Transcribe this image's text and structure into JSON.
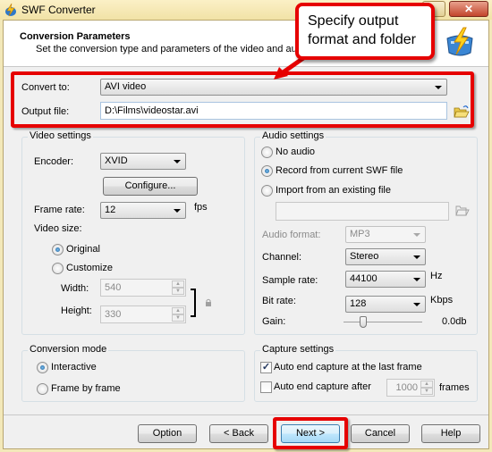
{
  "window": {
    "title": "SWF Converter",
    "close_glyph": "✕"
  },
  "header": {
    "title": "Conversion Parameters",
    "subtitle": "Set the conversion type and parameters of the video and audio",
    "logo_icon": "lightning-film-icon"
  },
  "annotation": {
    "callout_line1": "Specify output",
    "callout_line2": "format and folder",
    "color": "#e60000"
  },
  "output": {
    "convert_to_label": "Convert to:",
    "convert_to_value": "AVI video",
    "output_file_label": "Output file:",
    "output_file_value": "D:\\Films\\videostar.avi"
  },
  "video": {
    "group_title": "Video settings",
    "encoder_label": "Encoder:",
    "encoder_value": "XVID",
    "configure_label": "Configure...",
    "frame_rate_label": "Frame rate:",
    "frame_rate_value": "12",
    "fps_unit": "fps",
    "video_size_label": "Video size:",
    "original_label": "Original",
    "original_selected": true,
    "customize_label": "Customize",
    "width_label": "Width:",
    "width_value": "540",
    "height_label": "Height:",
    "height_value": "330"
  },
  "audio": {
    "group_title": "Audio settings",
    "no_audio_label": "No audio",
    "record_label": "Record from current SWF file",
    "record_selected": true,
    "import_label": "Import from an existing file",
    "import_path_value": "",
    "audio_format_label": "Audio format:",
    "audio_format_value": "MP3",
    "channel_label": "Channel:",
    "channel_value": "Stereo",
    "sample_rate_label": "Sample rate:",
    "sample_rate_value": "44100",
    "sample_rate_unit": "Hz",
    "bit_rate_label": "Bit rate:",
    "bit_rate_value": "128",
    "bit_rate_unit": "Kbps",
    "gain_label": "Gain:",
    "gain_value": "0.0db",
    "gain_slider_fraction": 0.25
  },
  "conversion_mode": {
    "group_title": "Conversion mode",
    "interactive_label": "Interactive",
    "interactive_selected": true,
    "frame_by_frame_label": "Frame by frame"
  },
  "capture": {
    "group_title": "Capture settings",
    "auto_end_last_label": "Auto end capture at the last frame",
    "auto_end_last_checked": true,
    "auto_end_after_label": "Auto end capture after",
    "auto_end_after_checked": false,
    "frames_value": "1000",
    "frames_unit": "frames",
    "check_glyph": "✓"
  },
  "buttons": {
    "option": "Option",
    "back": "< Back",
    "next": "Next >",
    "cancel": "Cancel",
    "help": "Help"
  }
}
